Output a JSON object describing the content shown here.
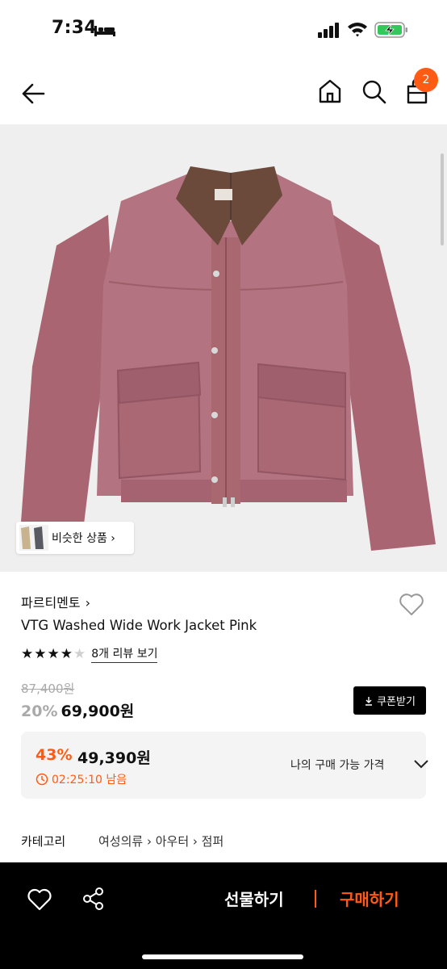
{
  "status_bar": {
    "time": "7:34"
  },
  "nav": {
    "cart_count": "2",
    "icons": [
      "back-arrow-icon",
      "home-icon",
      "search-icon",
      "shopping-bag-icon"
    ]
  },
  "gallery": {
    "similar_label": "비슷한 상품 ›"
  },
  "product": {
    "brand": "파르티멘토",
    "brand_chevron": "›",
    "name": "VTG Washed Wide Work Jacket Pink",
    "rating_stars": 4,
    "rating_max": 5,
    "review_link": "8개 리뷰 보기",
    "original_price": "87,400원",
    "discount_rate": "20%",
    "sale_price": "69,900원",
    "coupon_label": "쿠폰받기"
  },
  "best_price": {
    "rate": "43%",
    "price": "49,390원",
    "timer": "02:25:10 남음",
    "label": "나의 구매 가능 가격"
  },
  "category": {
    "label": "카테고리",
    "path": "여성의류 › 아우터 › 점퍼"
  },
  "bottom_bar": {
    "gift_label": "선물하기",
    "buy_label": "구매하기"
  },
  "colors": {
    "accent": "#ff5b14",
    "jacket": "#b06f7a",
    "collar": "#6b4a3c"
  }
}
